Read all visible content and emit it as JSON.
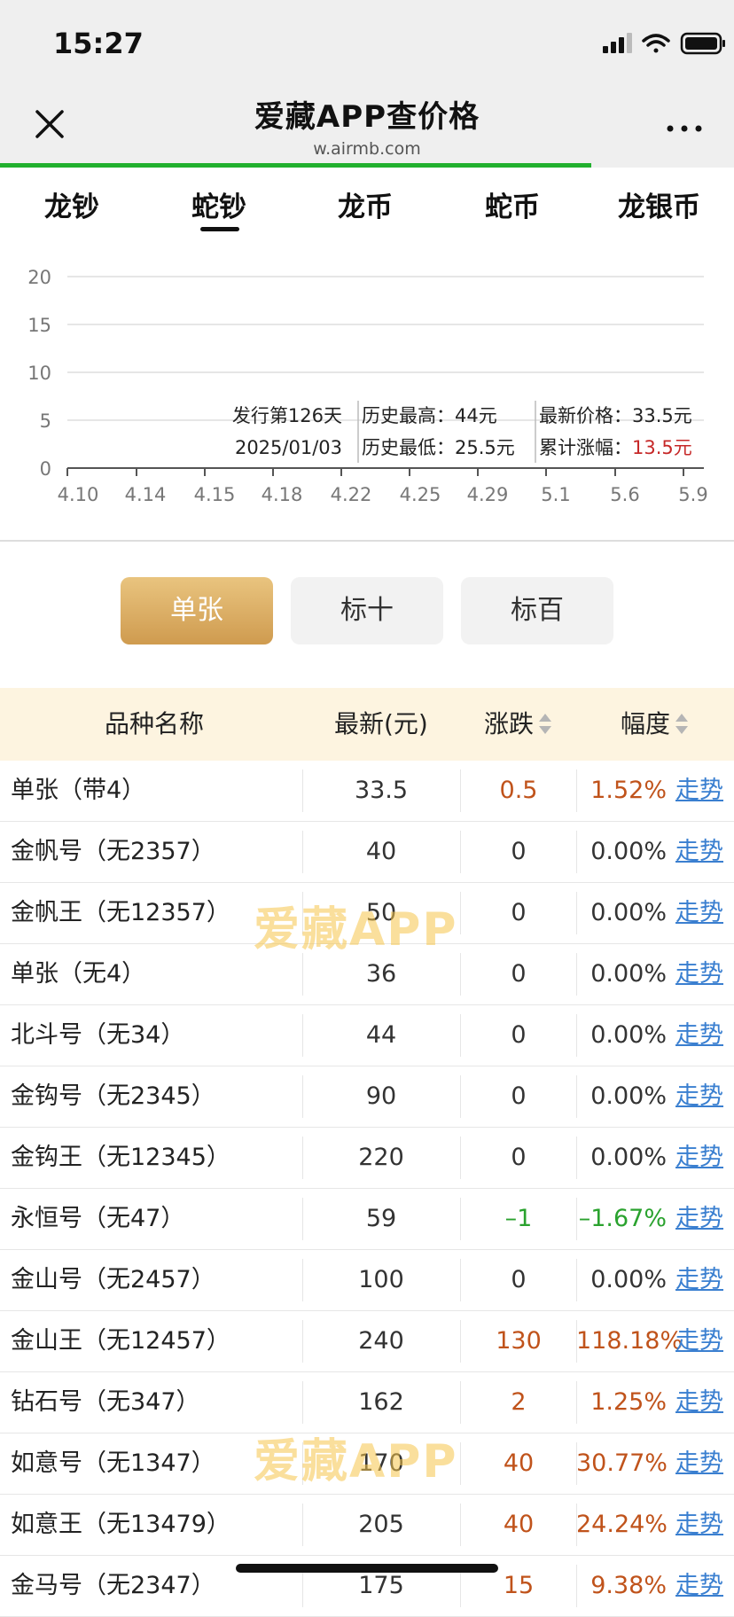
{
  "status": {
    "time": "15:27"
  },
  "header": {
    "title": "爱藏APP查价格",
    "url": "w.airmb.com"
  },
  "load_progress": 0.805,
  "tabs": [
    {
      "label": "龙钞",
      "active": false
    },
    {
      "label": "蛇钞",
      "active": true
    },
    {
      "label": "龙币",
      "active": false
    },
    {
      "label": "蛇币",
      "active": false
    },
    {
      "label": "龙银币",
      "active": false
    }
  ],
  "chart_data": {
    "type": "line",
    "categories": [
      "4.10",
      "4.14",
      "4.15",
      "4.18",
      "4.22",
      "4.25",
      "4.29",
      "5.1",
      "5.6",
      "5.9"
    ],
    "yticks": [
      "0",
      "5",
      "10",
      "15",
      "20"
    ],
    "ylim": [
      0,
      20
    ],
    "grid": true,
    "series": [],
    "info": {
      "issue_day": "发行第126天",
      "issue_date": "2025/01/03",
      "hist_high": "历史最高：44元",
      "hist_low": "历史最低：25.5元",
      "latest_price": "最新价格：33.5元",
      "cum_rise_label": "累计涨幅：",
      "cum_rise_value": "13.5元"
    }
  },
  "segments": [
    {
      "label": "单张",
      "active": true
    },
    {
      "label": "标十",
      "active": false
    },
    {
      "label": "标百",
      "active": false
    }
  ],
  "table": {
    "headers": {
      "name": "品种名称",
      "price": "最新(元)",
      "change": "涨跌",
      "pct": "幅度"
    },
    "trend_label": "走势",
    "rows": [
      {
        "name": "单张（带4）",
        "price": "33.5",
        "change": "0.5",
        "pct": "1.52%",
        "dir": "up"
      },
      {
        "name": "金帆号（无2357）",
        "price": "40",
        "change": "0",
        "pct": "0.00%",
        "dir": "flat"
      },
      {
        "name": "金帆王（无12357）",
        "price": "50",
        "change": "0",
        "pct": "0.00%",
        "dir": "flat"
      },
      {
        "name": "单张（无4）",
        "price": "36",
        "change": "0",
        "pct": "0.00%",
        "dir": "flat"
      },
      {
        "name": "北斗号（无34）",
        "price": "44",
        "change": "0",
        "pct": "0.00%",
        "dir": "flat"
      },
      {
        "name": "金钩号（无2345）",
        "price": "90",
        "change": "0",
        "pct": "0.00%",
        "dir": "flat"
      },
      {
        "name": "金钩王（无12345）",
        "price": "220",
        "change": "0",
        "pct": "0.00%",
        "dir": "flat"
      },
      {
        "name": "永恒号（无47）",
        "price": "59",
        "change": "–1",
        "pct": "–1.67%",
        "dir": "down"
      },
      {
        "name": "金山号（无2457）",
        "price": "100",
        "change": "0",
        "pct": "0.00%",
        "dir": "flat"
      },
      {
        "name": "金山王（无12457）",
        "price": "240",
        "change": "130",
        "pct": "118.18%",
        "dir": "up"
      },
      {
        "name": "钻石号（无347）",
        "price": "162",
        "change": "2",
        "pct": "1.25%",
        "dir": "up"
      },
      {
        "name": "如意号（无1347）",
        "price": "170",
        "change": "40",
        "pct": "30.77%",
        "dir": "up"
      },
      {
        "name": "如意王（无13479）",
        "price": "205",
        "change": "40",
        "pct": "24.24%",
        "dir": "up"
      },
      {
        "name": "金马号（无2347）",
        "price": "175",
        "change": "15",
        "pct": "9.38%",
        "dir": "up"
      }
    ]
  },
  "watermark": "爱藏APP",
  "colors": {
    "up": "#c0531b",
    "down": "#2aa22e",
    "progress": "#21b02e",
    "accent_gold": "#d9a85c",
    "link": "#3a7fd0",
    "rise_value": "#c62828"
  }
}
